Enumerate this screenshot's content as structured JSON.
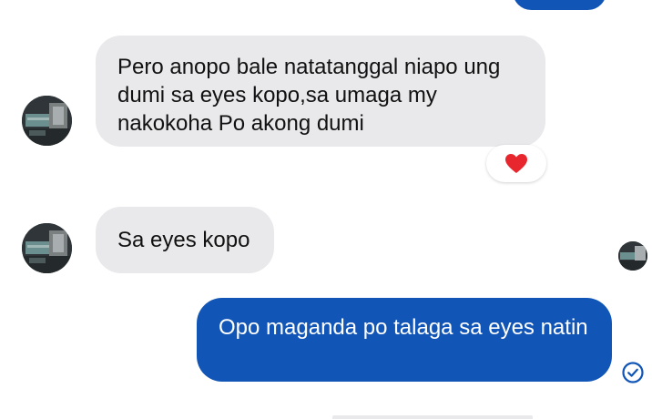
{
  "messages": [
    {
      "id": "m1",
      "direction": "incoming",
      "text": "Pero anopo bale natatanggal niapo ung dumi sa eyes kopo,sa umaga my nakokoha Po akong dumi",
      "reaction": "heart"
    },
    {
      "id": "m2",
      "direction": "incoming",
      "text": "Sa eyes kopo"
    },
    {
      "id": "m3",
      "direction": "outgoing",
      "text": "Opo maganda po talaga sa eyes natin",
      "status_icon": "sent-check-icon"
    }
  ],
  "colors": {
    "outgoing_bubble": "#1155b7",
    "incoming_bubble": "#e9e9eb",
    "heart": "#e8262d"
  }
}
